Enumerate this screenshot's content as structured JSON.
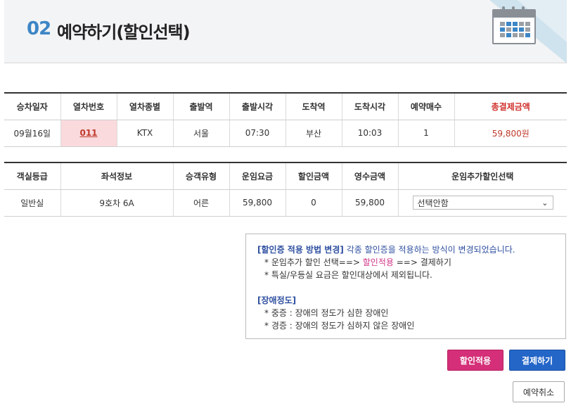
{
  "header": {
    "step_number": "02",
    "title": "예약하기(할인선택)"
  },
  "reservation_table": {
    "columns": [
      "승차일자",
      "열차번호",
      "열차종별",
      "출발역",
      "출발시각",
      "도착역",
      "도착시각",
      "예약매수",
      "총결제금액"
    ],
    "row": {
      "date": "09월16일",
      "train_no": "011",
      "train_type": "KTX",
      "dep_station": "서울",
      "dep_time": "07:30",
      "arr_station": "부산",
      "arr_time": "10:03",
      "count": "1",
      "total": "59,800원"
    }
  },
  "seat_table": {
    "columns": [
      "객실등급",
      "좌석정보",
      "승객유형",
      "운임요금",
      "할인금액",
      "영수금액",
      "운임추가할인선택"
    ],
    "row": {
      "grade": "일반실",
      "seat": "9호차 6A",
      "passenger": "어른",
      "fare": "59,800",
      "discount": "0",
      "received": "59,800",
      "discount_select": "선택안함"
    }
  },
  "notice": {
    "section1_title": "[할인증 적용 방법 변경]",
    "section1_desc": " 각종 할인증을 적용하는 방식이 변경되었습니다.",
    "item1_pre": "* 운임추가 할인 선택==> ",
    "item1_highlight": "할인적용",
    "item1_post": " ==> 결제하기",
    "item2": "* 특실/우등실 요금은 할인대상에서 제외됩니다.",
    "section2_title": "[장애정도]",
    "item3": "* 중증 : 장애의 정도가 심한 장애인",
    "item4": "* 경증 : 장애의 정도가 심하지 않은 장애인"
  },
  "buttons": {
    "apply_discount": "할인적용",
    "pay": "결제하기",
    "cancel_reservation": "예약취소"
  },
  "colors": {
    "accent_blue": "#2466c8",
    "accent_pink": "#d42f78",
    "total_red": "#d0312d"
  },
  "icons": {
    "header_icon": "calendar-icon",
    "select_chevron": "chevron-down-icon"
  }
}
